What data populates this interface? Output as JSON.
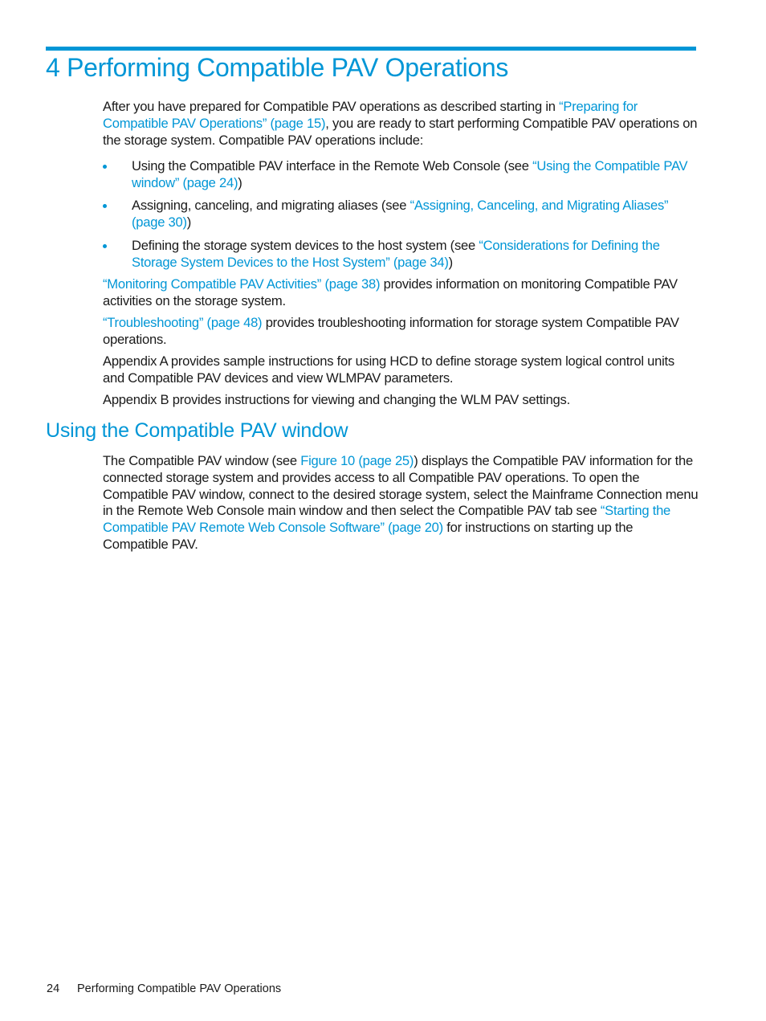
{
  "colors": {
    "accent": "#0096d6",
    "text": "#1a1a1a"
  },
  "chapter": {
    "title": "4 Performing Compatible PAV Operations"
  },
  "intro": {
    "before_link": "After you have prepared for Compatible PAV operations as described starting in ",
    "link": "“Preparing for Compatible PAV Operations” (page 15)",
    "after_link": ", you are ready to start performing Compatible PAV operations on the storage system. Compatible PAV operations include:"
  },
  "bullets": [
    {
      "text": "Using the Compatible PAV interface in the Remote Web Console (see ",
      "link": "“Using the Compatible PAV window” (page 24)",
      "tail": ")"
    },
    {
      "text": "Assigning, canceling, and migrating aliases (see ",
      "link": "“Assigning, Canceling, and Migrating Aliases” (page 30)",
      "tail": ")"
    },
    {
      "text": "Defining the storage system devices to the host system (see ",
      "link": "“Considerations for Defining the Storage System Devices to the Host System” (page 34)",
      "tail": ")"
    }
  ],
  "paragraphs": [
    {
      "link": "“Monitoring Compatible PAV Activities” (page 38)",
      "text": " provides information on monitoring Compatible PAV activities on the storage system."
    },
    {
      "link": "“Troubleshooting” (page 48)",
      "text": " provides troubleshooting information for storage system Compatible PAV operations."
    },
    {
      "text": "Appendix A provides sample instructions for using HCD to define storage system logical control units and Compatible PAV devices and view WLMPAV parameters."
    },
    {
      "text": "Appendix B provides instructions for viewing and changing the WLM PAV settings."
    }
  ],
  "section": {
    "title": "Using the Compatible PAV window",
    "p1_before": "The Compatible PAV window (see ",
    "p1_link1": "Figure 10 (page 25)",
    "p1_mid": ") displays the Compatible PAV information for the connected storage system and provides access to all Compatible PAV operations. To open the Compatible PAV window, connect to the desired storage system, select the Mainframe Connection menu in the Remote Web Console main window and then select the Compatible PAV tab see ",
    "p1_link2": "“Starting the Compatible PAV Remote Web Console Software” (page 20)",
    "p1_after": " for instructions on starting up the Compatible PAV."
  },
  "footer": {
    "page_number": "24",
    "running_title": "Performing Compatible PAV Operations"
  }
}
